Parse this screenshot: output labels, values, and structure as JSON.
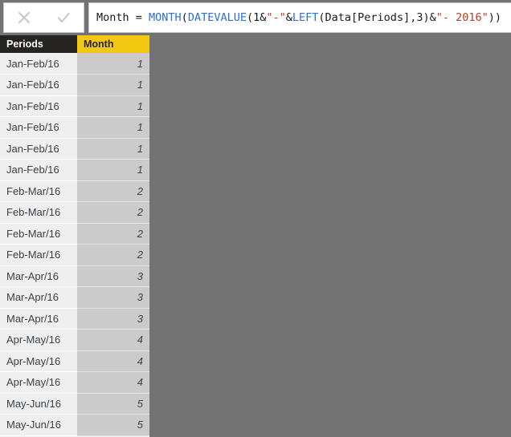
{
  "formula_bar": {
    "cancel_label": "Cancel",
    "commit_label": "Commit",
    "formula_plain": "Month = MONTH(DATEVALUE(1&\"-\"&LEFT(Data[Periods],3)&\"- 2016\"))",
    "tokens": [
      {
        "text": "Month = ",
        "type": "plain"
      },
      {
        "text": "MONTH",
        "type": "fn"
      },
      {
        "text": "(",
        "type": "plain"
      },
      {
        "text": "DATEVALUE",
        "type": "fn"
      },
      {
        "text": "(1&",
        "type": "plain"
      },
      {
        "text": "\"-\"",
        "type": "str"
      },
      {
        "text": "&",
        "type": "plain"
      },
      {
        "text": "LEFT",
        "type": "fn"
      },
      {
        "text": "(Data[Periods],3)&",
        "type": "plain"
      },
      {
        "text": "\"- 2016\"",
        "type": "str"
      },
      {
        "text": "))",
        "type": "plain"
      }
    ],
    "colors": {
      "function": "#2f6fd0",
      "string": "#c0392b",
      "text": "#1a1a1a"
    }
  },
  "table": {
    "columns": [
      {
        "key": "periods",
        "label": "Periods",
        "header_bg": "#252423",
        "header_fg": "#ffffff",
        "align": "left"
      },
      {
        "key": "month",
        "label": "Month",
        "header_bg": "#f2c811",
        "header_fg": "#252423",
        "align": "right"
      }
    ],
    "rows": [
      {
        "periods": "Jan-Feb/16",
        "month": "1"
      },
      {
        "periods": "Jan-Feb/16",
        "month": "1"
      },
      {
        "periods": "Jan-Feb/16",
        "month": "1"
      },
      {
        "periods": "Jan-Feb/16",
        "month": "1"
      },
      {
        "periods": "Jan-Feb/16",
        "month": "1"
      },
      {
        "periods": "Jan-Feb/16",
        "month": "1"
      },
      {
        "periods": "Feb-Mar/16",
        "month": "2"
      },
      {
        "periods": "Feb-Mar/16",
        "month": "2"
      },
      {
        "periods": "Feb-Mar/16",
        "month": "2"
      },
      {
        "periods": "Feb-Mar/16",
        "month": "2"
      },
      {
        "periods": "Mar-Apr/16",
        "month": "3"
      },
      {
        "periods": "Mar-Apr/16",
        "month": "3"
      },
      {
        "periods": "Mar-Apr/16",
        "month": "3"
      },
      {
        "periods": "Apr-May/16",
        "month": "4"
      },
      {
        "periods": "Apr-May/16",
        "month": "4"
      },
      {
        "periods": "Apr-May/16",
        "month": "4"
      },
      {
        "periods": "May-Jun/16",
        "month": "5"
      },
      {
        "periods": "May-Jun/16",
        "month": "5"
      }
    ]
  },
  "canvas": {
    "background": "#737373"
  }
}
